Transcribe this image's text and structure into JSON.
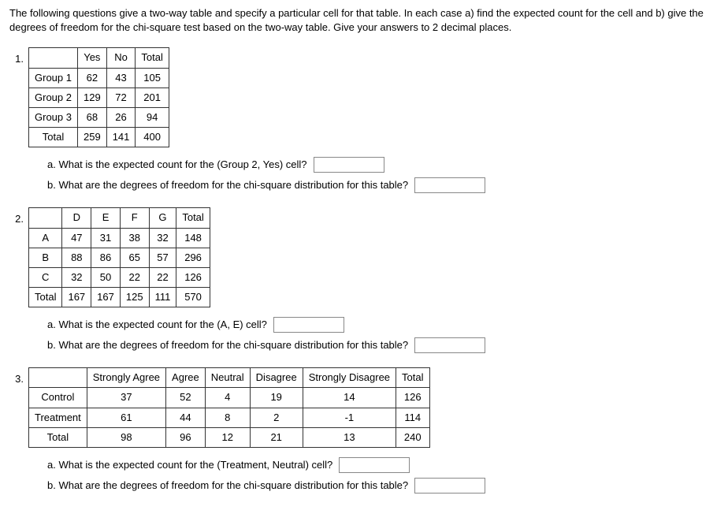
{
  "intro": "The following questions give a two-way table and specify a particular cell for that table. In each case a) find the expected count for the cell and b) give the degrees of freedom for the chi-square test based on the two-way table. Give your answers to 2 decimal places.",
  "problems": [
    {
      "num": "1.",
      "headers": [
        "",
        "Yes",
        "No",
        "Total"
      ],
      "rows": [
        [
          "Group 1",
          "62",
          "43",
          "105"
        ],
        [
          "Group 2",
          "129",
          "72",
          "201"
        ],
        [
          "Group 3",
          "68",
          "26",
          "94"
        ],
        [
          "Total",
          "259",
          "141",
          "400"
        ]
      ],
      "qa": "a. What is the expected count for the (Group 2, Yes) cell?",
      "qb": "b. What are the degrees of freedom for the chi-square distribution for this table?"
    },
    {
      "num": "2.",
      "headers": [
        "",
        "D",
        "E",
        "F",
        "G",
        "Total"
      ],
      "rows": [
        [
          "A",
          "47",
          "31",
          "38",
          "32",
          "148"
        ],
        [
          "B",
          "88",
          "86",
          "65",
          "57",
          "296"
        ],
        [
          "C",
          "32",
          "50",
          "22",
          "22",
          "126"
        ],
        [
          "Total",
          "167",
          "167",
          "125",
          "111",
          "570"
        ]
      ],
      "qa": "a. What is the expected count for the (A, E) cell?",
      "qb": "b. What are the degrees of freedom for the chi-square distribution for this table?"
    },
    {
      "num": "3.",
      "headers": [
        "",
        "Strongly Agree",
        "Agree",
        "Neutral",
        "Disagree",
        "Strongly Disagree",
        "Total"
      ],
      "rows": [
        [
          "Control",
          "37",
          "52",
          "4",
          "19",
          "14",
          "126"
        ],
        [
          "Treatment",
          "61",
          "44",
          "8",
          "2",
          "-1",
          "114"
        ],
        [
          "Total",
          "98",
          "96",
          "12",
          "21",
          "13",
          "240"
        ]
      ],
      "qa": "a. What is the expected count for the (Treatment, Neutral) cell?",
      "qb": "b. What are the degrees of freedom for the chi-square distribution for this table?"
    }
  ]
}
